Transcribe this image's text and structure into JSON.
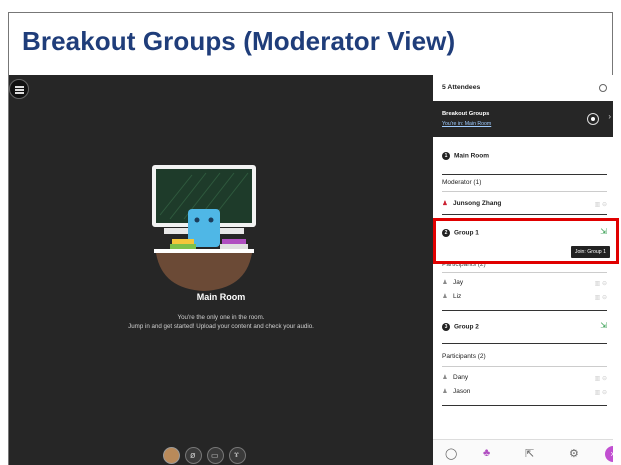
{
  "slide": {
    "title": "Breakout Groups (Moderator View)"
  },
  "stage": {
    "room_title": "Main Room",
    "line1": "You're the only one in the room.",
    "line2": "Jump in and get started! Upload your content and check your audio."
  },
  "panel": {
    "attendees": "5 Attendees",
    "breakout_title": "Breakout Groups",
    "breakout_sub": "You're in: Main Room",
    "main_room_num": "1",
    "main_room": "Main Room",
    "moderator_header": "Moderator (1)",
    "moderator_name": "Junsong Zhang",
    "group1_num": "2",
    "group1": "Group 1",
    "group1_participants": "Participants (2)",
    "group1_members": [
      "Jay",
      "Liz"
    ],
    "join_tooltip": "Join: Group 1",
    "group2_num": "3",
    "group2": "Group 2",
    "group2_participants": "Participants (2)",
    "group2_members": [
      "Dany",
      "Jason"
    ]
  },
  "icons": {
    "menu": "menu-icon",
    "collapse": "collapse-icon",
    "stop": "stop-icon",
    "join": "join-icon",
    "chat": "chat-icon",
    "attendees": "attendees-icon",
    "share": "share-icon",
    "settings": "gear-icon",
    "close": "close-icon"
  },
  "colors": {
    "title": "#1f3d7a",
    "highlight": "#e00000",
    "join": "#2e9a4a",
    "close_pill": "#c14fd1"
  }
}
